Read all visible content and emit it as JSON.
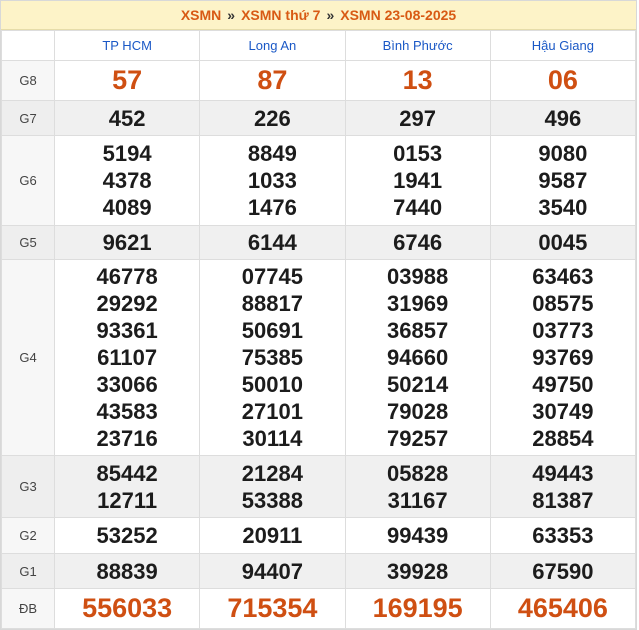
{
  "breadcrumb": {
    "items": [
      "XSMN",
      "XSMN thứ 7",
      "XSMN 23-08-2025"
    ],
    "separator": "»"
  },
  "provinces": [
    "TP HCM",
    "Long An",
    "Bình Phước",
    "Hậu Giang"
  ],
  "prizes": [
    {
      "label": "G8",
      "results": [
        [
          "57"
        ],
        [
          "87"
        ],
        [
          "13"
        ],
        [
          "06"
        ]
      ]
    },
    {
      "label": "G7",
      "results": [
        [
          "452"
        ],
        [
          "226"
        ],
        [
          "297"
        ],
        [
          "496"
        ]
      ]
    },
    {
      "label": "G6",
      "results": [
        [
          "5194",
          "4378",
          "4089"
        ],
        [
          "8849",
          "1033",
          "1476"
        ],
        [
          "0153",
          "1941",
          "7440"
        ],
        [
          "9080",
          "9587",
          "3540"
        ]
      ]
    },
    {
      "label": "G5",
      "results": [
        [
          "9621"
        ],
        [
          "6144"
        ],
        [
          "6746"
        ],
        [
          "0045"
        ]
      ]
    },
    {
      "label": "G4",
      "results": [
        [
          "46778",
          "29292",
          "93361",
          "61107",
          "33066",
          "43583",
          "23716"
        ],
        [
          "07745",
          "88817",
          "50691",
          "75385",
          "50010",
          "27101",
          "30114"
        ],
        [
          "03988",
          "31969",
          "36857",
          "94660",
          "50214",
          "79028",
          "79257"
        ],
        [
          "63463",
          "08575",
          "03773",
          "93769",
          "49750",
          "30749",
          "28854"
        ]
      ]
    },
    {
      "label": "G3",
      "results": [
        [
          "85442",
          "12711"
        ],
        [
          "21284",
          "53388"
        ],
        [
          "05828",
          "31167"
        ],
        [
          "49443",
          "81387"
        ]
      ]
    },
    {
      "label": "G2",
      "results": [
        [
          "53252"
        ],
        [
          "20911"
        ],
        [
          "99439"
        ],
        [
          "63353"
        ]
      ]
    },
    {
      "label": "G1",
      "results": [
        [
          "88839"
        ],
        [
          "94407"
        ],
        [
          "39928"
        ],
        [
          "67590"
        ]
      ]
    },
    {
      "label": "ĐB",
      "results": [
        [
          "556033"
        ],
        [
          "715354"
        ],
        [
          "169195"
        ],
        [
          "465406"
        ]
      ]
    }
  ],
  "colors": {
    "accent": "#cf4f12",
    "header_bg": "#fdf3c8",
    "province": "#1a58c6"
  }
}
